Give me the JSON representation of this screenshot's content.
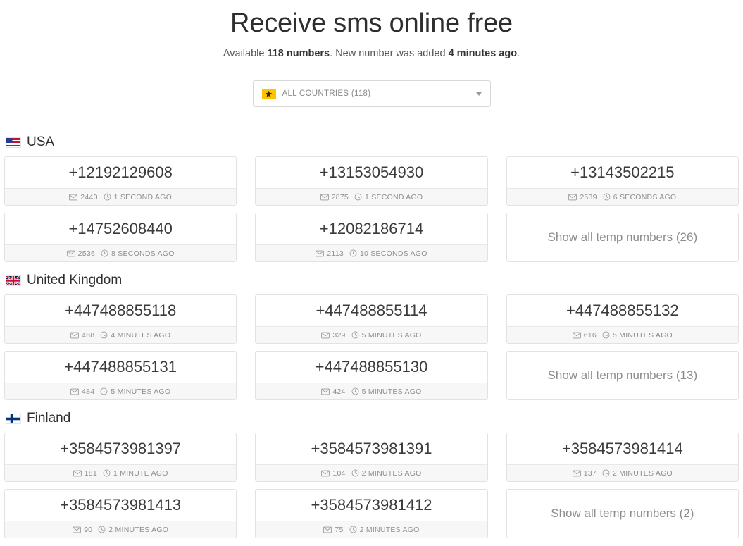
{
  "header": {
    "title": "Receive sms online free",
    "subtitle_prefix": "Available ",
    "subtitle_count": "118 numbers",
    "subtitle_middle": ". New number was added ",
    "subtitle_time": "4 minutes ago",
    "subtitle_suffix": "."
  },
  "filter": {
    "icon": "star-icon",
    "star_color": "#fdc300",
    "label": "ALL COUNTRIES (118)",
    "caret": "chevron-down-icon"
  },
  "meta_icons": {
    "messages": "envelope-icon",
    "time": "clock-icon"
  },
  "sections": [
    {
      "country": "USA",
      "flag": "flag-usa",
      "cards": [
        {
          "number": "+12192129608",
          "messages": "2440",
          "time": "1 SECOND AGO"
        },
        {
          "number": "+13153054930",
          "messages": "2875",
          "time": "1 SECOND AGO"
        },
        {
          "number": "+13143502215",
          "messages": "2539",
          "time": "6 SECONDS AGO"
        },
        {
          "number": "+14752608440",
          "messages": "2536",
          "time": "8 SECONDS AGO"
        },
        {
          "number": "+12082186714",
          "messages": "2113",
          "time": "10 SECONDS AGO"
        }
      ],
      "show_all": "Show all temp numbers (26)"
    },
    {
      "country": "United Kingdom",
      "flag": "flag-uk",
      "cards": [
        {
          "number": "+447488855118",
          "messages": "468",
          "time": "4 MINUTES AGO"
        },
        {
          "number": "+447488855114",
          "messages": "329",
          "time": "5 MINUTES AGO"
        },
        {
          "number": "+447488855132",
          "messages": "616",
          "time": "5 MINUTES AGO"
        },
        {
          "number": "+447488855131",
          "messages": "484",
          "time": "5 MINUTES AGO"
        },
        {
          "number": "+447488855130",
          "messages": "424",
          "time": "5 MINUTES AGO"
        }
      ],
      "show_all": "Show all temp numbers (13)"
    },
    {
      "country": "Finland",
      "flag": "flag-finland",
      "cards": [
        {
          "number": "+3584573981397",
          "messages": "181",
          "time": "1 MINUTE AGO"
        },
        {
          "number": "+3584573981391",
          "messages": "104",
          "time": "2 MINUTES AGO"
        },
        {
          "number": "+3584573981414",
          "messages": "137",
          "time": "2 MINUTES AGO"
        },
        {
          "number": "+3584573981413",
          "messages": "90",
          "time": "2 MINUTES AGO"
        },
        {
          "number": "+3584573981412",
          "messages": "75",
          "time": "2 MINUTES AGO"
        }
      ],
      "show_all": "Show all temp numbers (2)"
    }
  ]
}
